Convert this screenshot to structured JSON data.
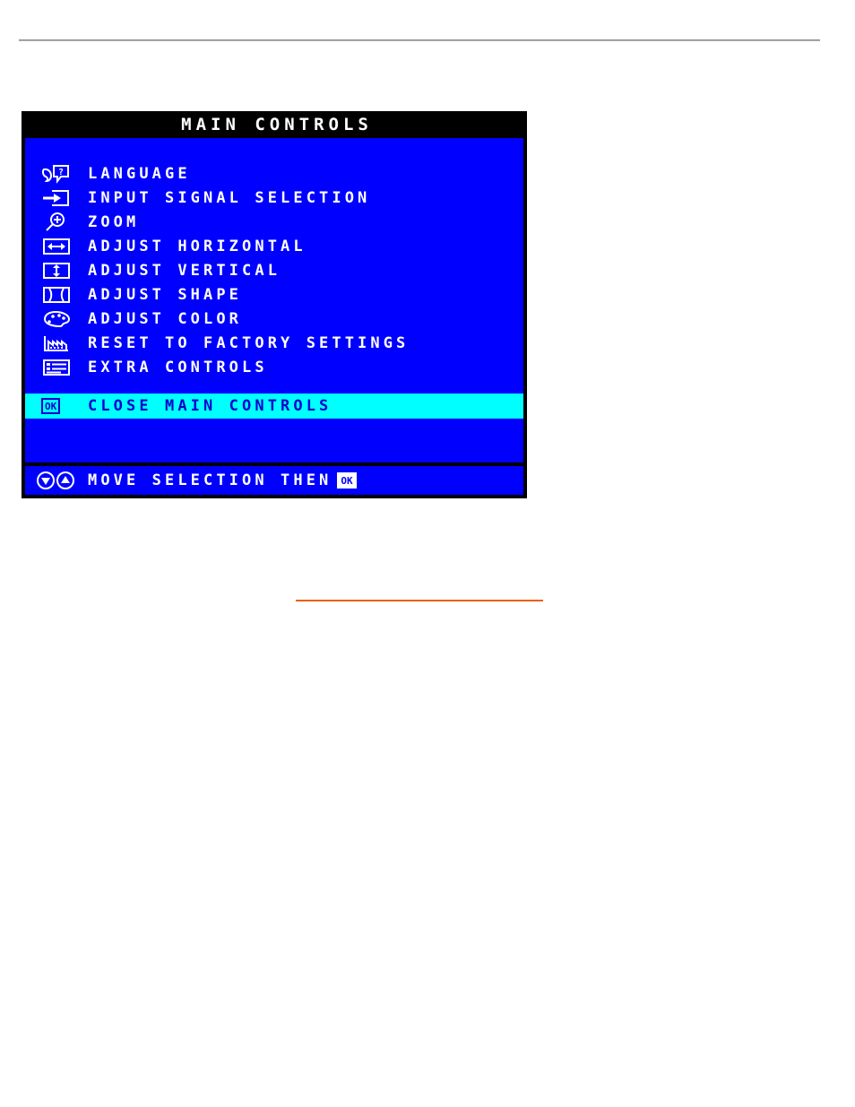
{
  "page": {
    "background_color": "#ffffff",
    "top_rule": {
      "color": "#7d7d7d"
    },
    "bottom_rule": {
      "color": "#e8620a"
    }
  },
  "osd": {
    "title": "MAIN CONTROLS",
    "colors": {
      "frame": "#000000",
      "background": "#0000ff",
      "text": "#ffffff",
      "highlight_background": "#00ffff",
      "highlight_text": "#0000cc"
    },
    "menu_items": [
      {
        "label": "LANGUAGE",
        "icon": "speech-bubble-question-icon"
      },
      {
        "label": "INPUT SIGNAL SELECTION",
        "icon": "arrow-into-box-icon"
      },
      {
        "label": "ZOOM",
        "icon": "magnifier-plus-icon"
      },
      {
        "label": "ADJUST HORIZONTAL",
        "icon": "horizontal-arrows-box-icon"
      },
      {
        "label": "ADJUST VERTICAL",
        "icon": "vertical-arrows-box-icon"
      },
      {
        "label": "ADJUST SHAPE",
        "icon": "pincushion-shape-icon"
      },
      {
        "label": "ADJUST COLOR",
        "icon": "paint-palette-icon"
      },
      {
        "label": "RESET TO FACTORY SETTINGS",
        "icon": "factory-icon"
      },
      {
        "label": "EXTRA CONTROLS",
        "icon": "list-lines-icon"
      }
    ],
    "selected_item": {
      "label": "CLOSE MAIN CONTROLS",
      "icon": "ok-button-icon",
      "icon_text": "OK"
    },
    "footer": {
      "label": "MOVE SELECTION THEN",
      "down_icon": "circle-down-arrow-icon",
      "up_icon": "circle-up-arrow-icon",
      "ok_icon": "ok-button-icon",
      "ok_icon_text": "OK"
    }
  }
}
